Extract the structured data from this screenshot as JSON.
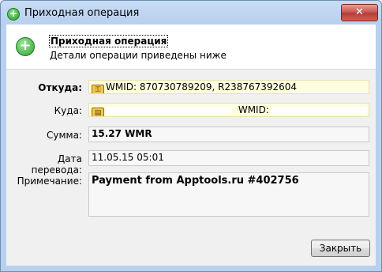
{
  "window": {
    "title": "Приходная операция",
    "close_symbol": "✕"
  },
  "header": {
    "title": "Приходная операция",
    "subtitle": "Детали операции приведены ниже",
    "icon": "plus-circle-icon"
  },
  "form": {
    "from_label": "Откуда:",
    "from_value": "WMID: 870730789209, R238767392604",
    "to_label": "Куда:",
    "to_value": "WMID:",
    "amount_label": "Сумма:",
    "amount_value": "15.27 WMR",
    "date_label": "Дата перевода:",
    "date_value": "11.05.15 05:01",
    "note_label": "Примечание:",
    "note_value": "Payment from Apptools.ru #402756"
  },
  "buttons": {
    "close_label": "Закрыть"
  },
  "colors": {
    "field_highlight": "#fefde0",
    "title_bar": "#b7d0ee",
    "accent_green": "#2f9e2f"
  }
}
